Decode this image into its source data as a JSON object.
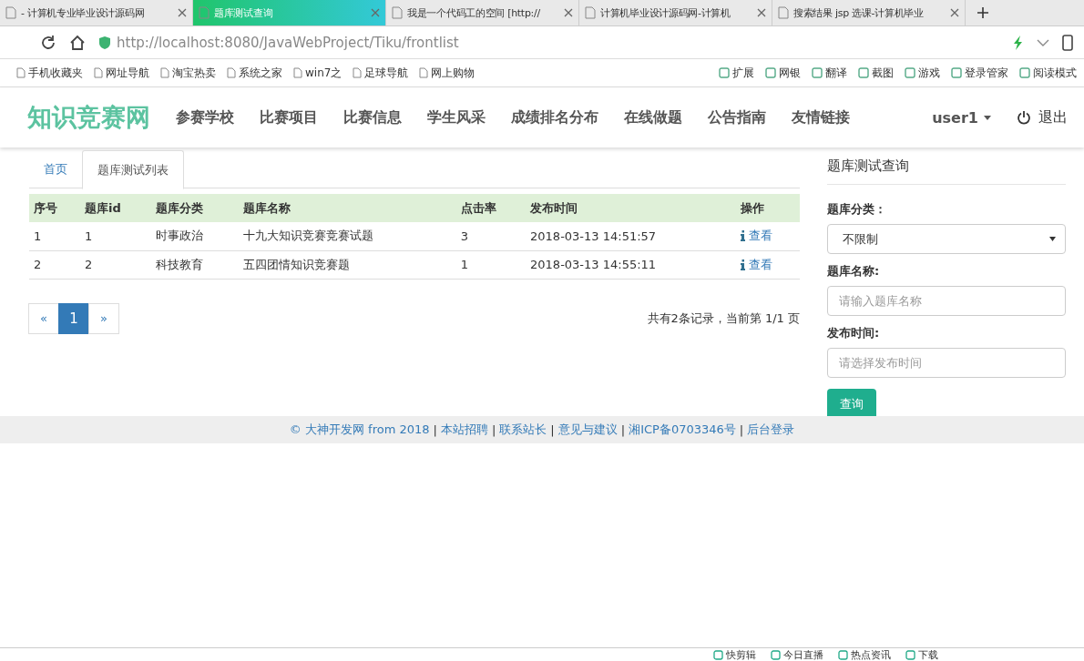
{
  "browser": {
    "tabs": [
      {
        "title": "- 计算机专业毕业设计源码网",
        "selected": false
      },
      {
        "title": "题库测试查询",
        "selected": true
      },
      {
        "title": "我是一个代码工的空间 [http://",
        "selected": false
      },
      {
        "title": "计算机毕业设计源码网-计算机",
        "selected": false
      },
      {
        "title": "搜索结果 jsp 选课-计算机毕业",
        "selected": false
      }
    ],
    "url": "http://localhost:8080/JavaWebProject/Tiku/frontlist",
    "bookmarks": [
      "手机收藏夹",
      "网址导航",
      "淘宝热卖",
      "系统之家",
      "win7之",
      "足球导航",
      "网上购物"
    ],
    "tools": [
      "扩展",
      "网银",
      "翻译",
      "截图",
      "游戏",
      "登录管家",
      "阅读模式"
    ]
  },
  "navbar": {
    "brand": "知识竞赛网",
    "items": [
      "参赛学校",
      "比赛项目",
      "比赛信息",
      "学生风采",
      "成绩排名分布",
      "在线做题",
      "公告指南",
      "友情链接"
    ],
    "user": "user1",
    "logout": "退出"
  },
  "tabs": [
    {
      "label": "首页",
      "selected": false
    },
    {
      "label": "题库测试列表",
      "selected": true
    }
  ],
  "table": {
    "columns": [
      "序号",
      "题库id",
      "题库分类",
      "题库名称",
      "点击率",
      "发布时间",
      "操作"
    ],
    "rows": [
      [
        "1",
        "1",
        "时事政治",
        "十九大知识竞赛竞赛试题",
        "3",
        "2018-03-13 14:51:57",
        "查看"
      ],
      [
        "2",
        "2",
        "科技教育",
        "五四团情知识竞赛题",
        "1",
        "2018-03-13 14:55:11",
        "查看"
      ]
    ]
  },
  "pagination": {
    "pages": [
      {
        "label": "«",
        "selected": false
      },
      {
        "label": "1",
        "selected": true
      },
      {
        "label": "»",
        "selected": false
      }
    ],
    "summary": "共有2条记录，当前第 1/1 页"
  },
  "search_panel": {
    "title": "题库测试查询",
    "fields": [
      {
        "kind": "select",
        "label": "题库分类：",
        "value": "不限制"
      },
      {
        "kind": "text",
        "label": "题库名称:",
        "placeholder": "请输入题库名称"
      },
      {
        "kind": "text",
        "label": "发布时间:",
        "placeholder": "请选择发布时间"
      }
    ],
    "button": "查询"
  },
  "footer": {
    "links": [
      "© 大神开发网 from 2018",
      "本站招聘",
      "联系站长",
      "意见与建议",
      "湘ICP备0703346号",
      "后台登录"
    ],
    "separator": "|"
  },
  "status_bar": [
    "快剪辑",
    "今日直播",
    "热点资讯",
    "下载"
  ]
}
